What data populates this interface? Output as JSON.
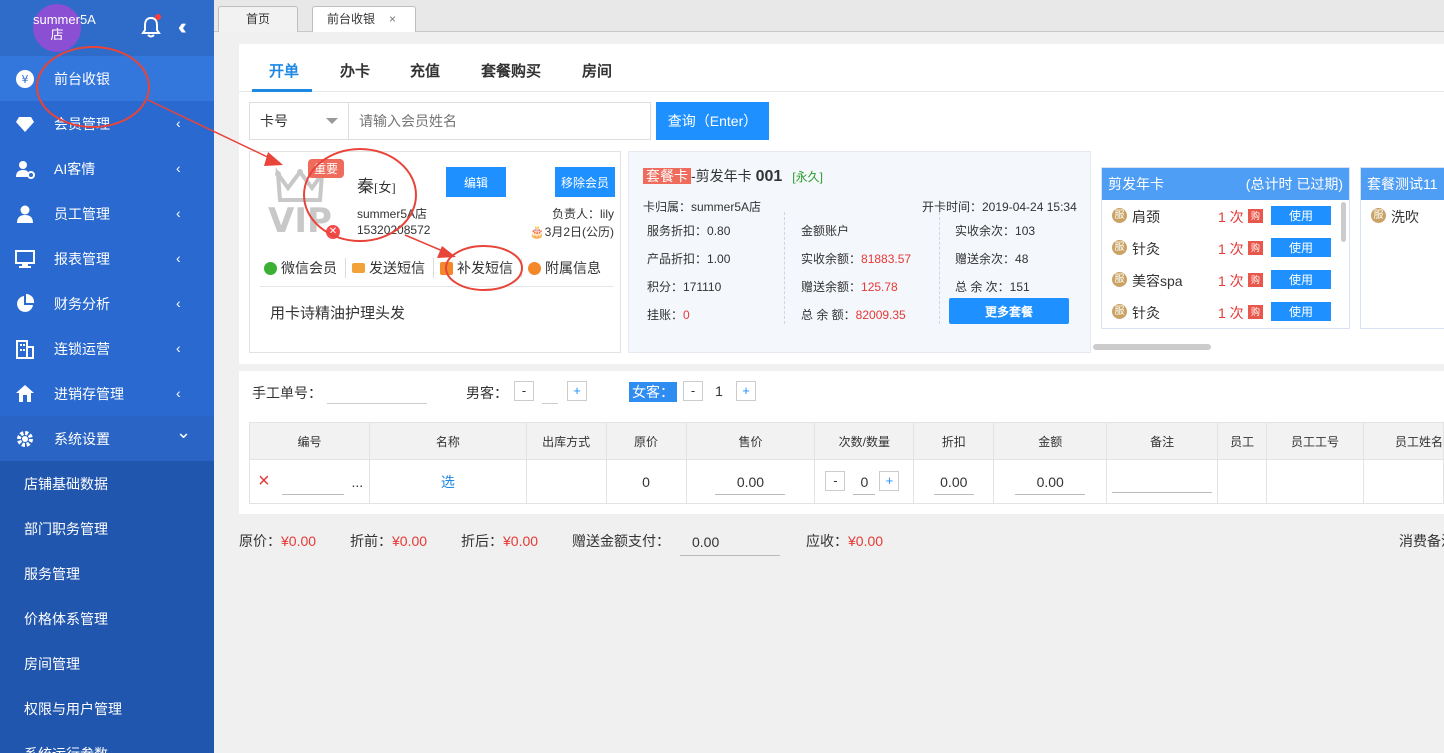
{
  "sidebar": {
    "avatar_text": "summer5A店",
    "items": [
      {
        "label": "前台收银",
        "icon": "yen-icon",
        "chevron": ""
      },
      {
        "label": "会员管理",
        "icon": "diamond-icon",
        "chevron": "‹"
      },
      {
        "label": "AI客情",
        "icon": "user-settings-icon",
        "chevron": "‹"
      },
      {
        "label": "员工管理",
        "icon": "staff-icon",
        "chevron": "‹"
      },
      {
        "label": "报表管理",
        "icon": "monitor-icon",
        "chevron": "‹"
      },
      {
        "label": "财务分析",
        "icon": "pie-icon",
        "chevron": "‹"
      },
      {
        "label": "连锁运营",
        "icon": "building-icon",
        "chevron": "‹"
      },
      {
        "label": "进销存管理",
        "icon": "home-icon",
        "chevron": "‹"
      },
      {
        "label": "系统设置",
        "icon": "gear-icon",
        "chevron": "⌄"
      }
    ],
    "subitems": [
      "店铺基础数据",
      "部门职务管理",
      "服务管理",
      "价格体系管理",
      "房间管理",
      "权限与用户管理",
      "系统运行参数"
    ]
  },
  "page_tabs": [
    {
      "label": "首页"
    },
    {
      "label": "前台收银",
      "close": "×"
    }
  ],
  "subtabs": [
    "开单",
    "办卡",
    "充值",
    "套餐购买",
    "房间"
  ],
  "search": {
    "select_value": "卡号",
    "placeholder": "请输入会员姓名",
    "button": "查询（Enter）"
  },
  "member": {
    "tag": "重要",
    "name": "秦",
    "gender": "[女]",
    "store": "summer5A店",
    "phone": "15320208572",
    "edit": "编辑",
    "remove": "移除会员",
    "owner": "负责人：lily",
    "birthday": "3月2日(公历)",
    "links": [
      "微信会员",
      "发送短信",
      "补发短信",
      "附属信息"
    ],
    "note": "用卡诗精油护理头发"
  },
  "card": {
    "tag": "套餐卡",
    "type": "-剪发年卡",
    "no": "001",
    "validity": "[永久]",
    "belong": "卡归属：summer5A店",
    "open_time": "开卡时间：2019-04-24 15:34",
    "col1": [
      {
        "k": "服务折扣：",
        "v": "0.80"
      },
      {
        "k": "产品折扣：",
        "v": "1.00"
      },
      {
        "k": "积分：",
        "v": "171110"
      },
      {
        "k": "挂账：",
        "v": "0"
      }
    ],
    "col2_title": "金额账户",
    "col2": [
      {
        "k": "实收余额：",
        "v": "81883.57"
      },
      {
        "k": "赠送余额：",
        "v": "125.78"
      },
      {
        "k": "总 余 额：",
        "v": "82009.35"
      }
    ],
    "col3": [
      {
        "k": "实收余次：",
        "v": "103"
      },
      {
        "k": "赠送余次：",
        "v": "48"
      },
      {
        "k": "总 余 次：",
        "v": "151"
      }
    ],
    "more": "更多套餐"
  },
  "packages": [
    {
      "title": "剪发年卡",
      "status": "(总计时 已过期)",
      "items": [
        {
          "name": "肩颈",
          "count": "1 次"
        },
        {
          "name": "针灸",
          "count": "1 次"
        },
        {
          "name": "美容spa",
          "count": "1 次"
        },
        {
          "name": "针灸",
          "count": "1 次"
        }
      ]
    },
    {
      "title": "套餐测试11",
      "status": "",
      "items": [
        {
          "name": "洗吹",
          "count": ""
        }
      ]
    }
  ],
  "pkg_labels": {
    "fu": "服",
    "gou": "购",
    "use": "使用"
  },
  "order": {
    "manual_no": "手工单号：",
    "male": "男客：",
    "male_count": "",
    "female": "女客：",
    "female_count": "1",
    "minus": "-",
    "plus": "+",
    "columns": [
      "编号",
      "名称",
      "出库方式",
      "原价",
      "售价",
      "次数/数量",
      "折扣",
      "金额",
      "备注",
      "员工",
      "员工工号",
      "员工姓名"
    ],
    "row": {
      "del": "×",
      "ellipsis": "...",
      "pick": "选",
      "price": "0",
      "sale": "0.00",
      "qty": "0",
      "discount": "0.00",
      "amount": "0.00"
    }
  },
  "totals": {
    "orig_label": "原价：",
    "orig": "¥0.00",
    "before_label": "折前：",
    "before": "¥0.00",
    "after_label": "折后：",
    "after": "¥0.00",
    "gift_label": "赠送金额支付：",
    "gift": "0.00",
    "due_label": "应收：",
    "due": "¥0.00",
    "right": "消费备注"
  },
  "colors": {
    "sidebar": "#2a6ad0",
    "accent": "#1e90ff",
    "red": "#e53935",
    "annotation": "#e8443a"
  }
}
